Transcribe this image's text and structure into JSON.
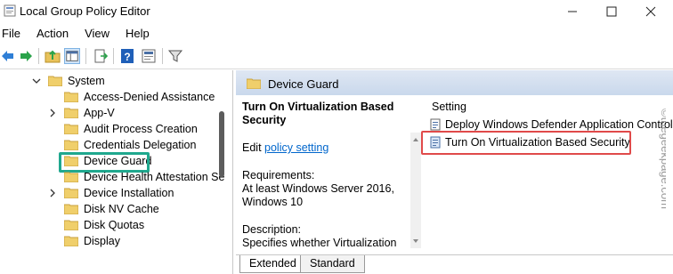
{
  "window": {
    "title": "Local Group Policy Editor"
  },
  "menu": [
    "File",
    "Action",
    "View",
    "Help"
  ],
  "tree": {
    "items": [
      {
        "label": "System",
        "expanded": true,
        "level": 0
      },
      {
        "label": "Access-Denied Assistance",
        "level": 1
      },
      {
        "label": "App-V",
        "level": 1,
        "collapsed": true
      },
      {
        "label": "Audit Process Creation",
        "level": 1
      },
      {
        "label": "Credentials Delegation",
        "level": 1
      },
      {
        "label": "Device Guard",
        "level": 1,
        "selected": true
      },
      {
        "label": "Device Health Attestation Se",
        "level": 1
      },
      {
        "label": "Device Installation",
        "level": 1,
        "collapsed": true
      },
      {
        "label": "Disk NV Cache",
        "level": 1
      },
      {
        "label": "Disk Quotas",
        "level": 1
      },
      {
        "label": "Display",
        "level": 1
      }
    ]
  },
  "right": {
    "header": "Device Guard",
    "policy_title": "Turn On Virtualization Based Security",
    "edit_prefix": "Edit",
    "edit_link": "policy setting",
    "requirements_label": "Requirements:",
    "requirements_text": "At least Windows Server 2016, Windows 10",
    "description_label": "Description:",
    "description_text": "Specifies whether Virtualization",
    "list_header": "Setting",
    "rows": [
      "Deploy Windows Defender Application Control",
      "Turn On Virtualization Based Security"
    ]
  },
  "tabs": [
    "Extended",
    "Standard"
  ],
  "watermark": "©thegeekpage.com",
  "colors": {
    "green_highlight": "#1fa88e",
    "red_highlight": "#e04a4a",
    "link": "#0066cc"
  }
}
